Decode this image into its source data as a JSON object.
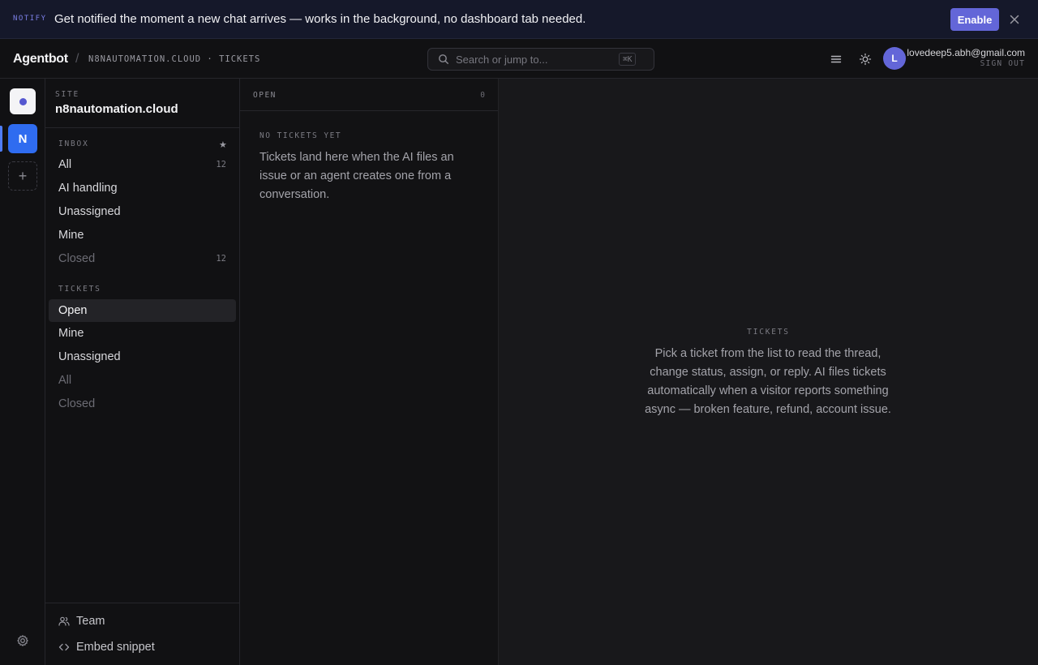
{
  "banner": {
    "tag": "NOTIFY",
    "message": "Get notified the moment a new chat arrives — works in the background, no dashboard tab needed.",
    "enable_label": "Enable",
    "close_icon": "close-icon"
  },
  "header": {
    "brand": "Agentbot",
    "separator": "/",
    "breadcrumb": "N8NAUTOMATION.CLOUD · TICKETS",
    "search_placeholder": "Search or jump to...",
    "search_shortcut": "⌘K",
    "user": {
      "avatar_initial": "L",
      "email": "lovedeep5.abh@gmail.com",
      "sign_out": "SIGN OUT"
    }
  },
  "rail": {
    "sites": [
      {
        "name": "site-dot",
        "initial": ""
      },
      {
        "name": "n8nautomation",
        "initial": "N"
      }
    ],
    "add_label": "+"
  },
  "sidebar": {
    "site_label": "SITE",
    "site_name": "n8nautomation.cloud",
    "inbox_label": "INBOX",
    "inbox_star": "★",
    "inbox_items": [
      {
        "label": "All",
        "count": "12"
      },
      {
        "label": "AI handling",
        "count": ""
      },
      {
        "label": "Unassigned",
        "count": ""
      },
      {
        "label": "Mine",
        "count": ""
      },
      {
        "label": "Closed",
        "count": "12"
      }
    ],
    "tickets_label": "TICKETS",
    "ticket_items": [
      {
        "label": "Open"
      },
      {
        "label": "Mine"
      },
      {
        "label": "Unassigned"
      },
      {
        "label": "All"
      },
      {
        "label": "Closed"
      }
    ],
    "footer": [
      {
        "label": "Team"
      },
      {
        "label": "Embed snippet"
      }
    ]
  },
  "list": {
    "title": "OPEN",
    "count": "0",
    "empty_title": "NO TICKETS YET",
    "empty_body": "Tickets land here when the AI files an issue or an agent creates one from a conversation."
  },
  "detail": {
    "title": "TICKETS",
    "body": "Pick a ticket from the list to read the thread, change status, assign, or reply. AI files tickets automatically when a visitor reports something async — broken feature, refund, account issue."
  },
  "colors": {
    "accent": "#6366d8",
    "site_active": "#2f6cf0",
    "background": "#141416"
  }
}
